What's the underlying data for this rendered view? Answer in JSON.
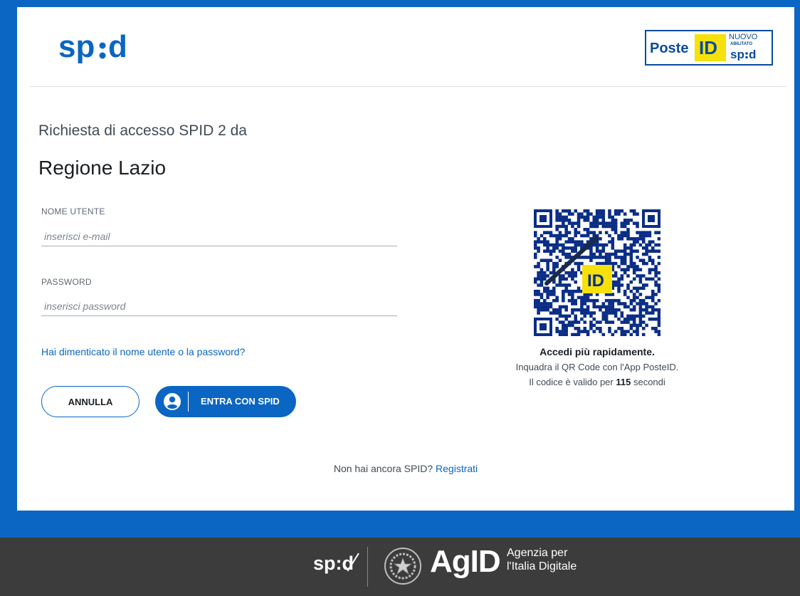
{
  "header": {
    "spid_logo_text": "sp:d",
    "provider": {
      "poste": "Poste",
      "id": "ID",
      "nuovo": "NUOVO",
      "abilitato": "ABILITATO",
      "spid": "sp:d"
    }
  },
  "request": {
    "label": "Richiesta di accesso SPID 2 da",
    "organization": "Regione Lazio"
  },
  "form": {
    "username_label": "NOME UTENTE",
    "username_placeholder": "inserisci e-mail",
    "password_label": "PASSWORD",
    "password_placeholder": "inserisci password",
    "forgot_link": "Hai dimenticato il nome utente o la password?",
    "cancel_label": "ANNULLA",
    "submit_label": "ENTRA CON SPID"
  },
  "qr": {
    "badge": "ID",
    "title": "Accedi più rapidamente.",
    "instruction": "Inquadra il QR Code con l'App PosteID.",
    "validity_prefix": "Il codice è valido per",
    "validity_seconds": "115",
    "validity_suffix": "secondi"
  },
  "register": {
    "question": "Non hai ancora SPID?",
    "link": "Registrati"
  },
  "footer": {
    "spid_text": "sp:d",
    "agid": "AgID",
    "agency_line1": "Agenzia per",
    "agency_line2": "l'Italia Digitale"
  },
  "colors": {
    "brand_blue": "#0a66c2",
    "poste_yellow": "#f6e10b",
    "footer_bg": "#3c3c3c"
  }
}
